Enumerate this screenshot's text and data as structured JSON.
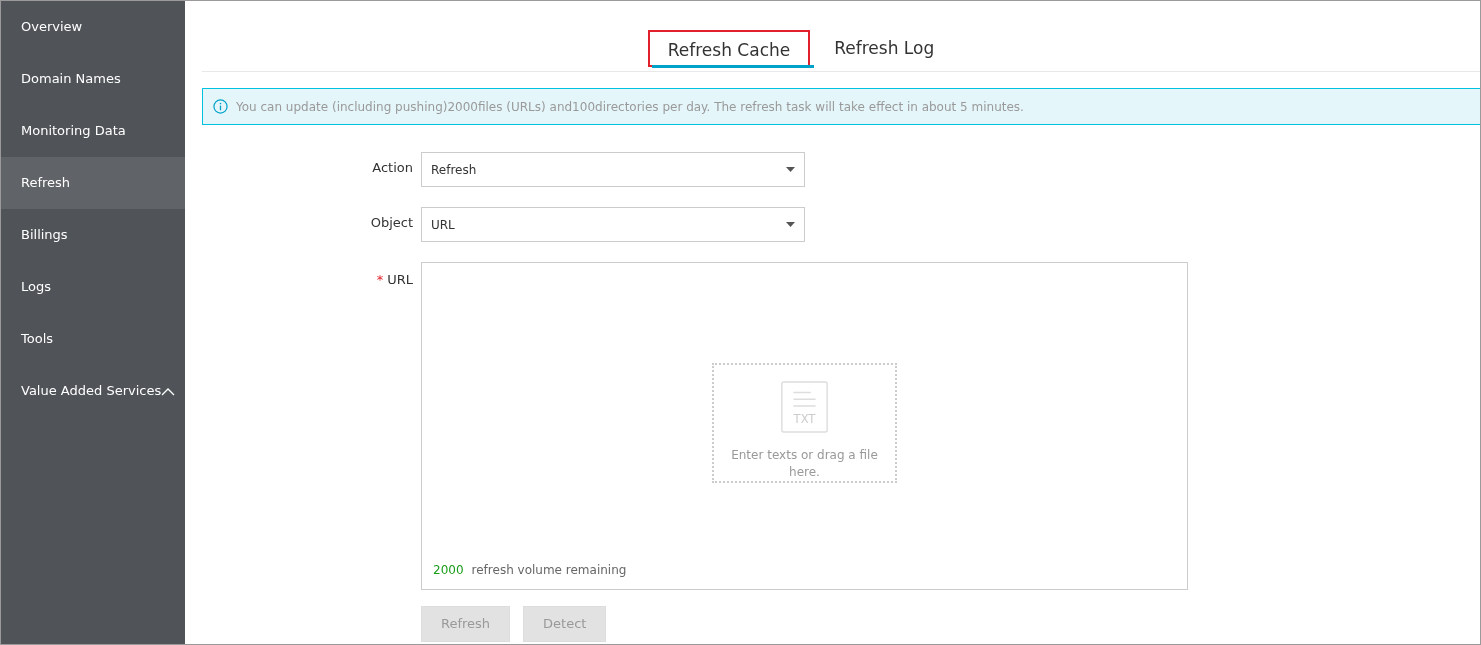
{
  "sidebar": {
    "items": [
      {
        "label": "Overview",
        "selected": false
      },
      {
        "label": "Domain Names",
        "selected": false
      },
      {
        "label": "Monitoring Data",
        "selected": false
      },
      {
        "label": "Refresh",
        "selected": true
      },
      {
        "label": "Billings",
        "selected": false
      },
      {
        "label": "Logs",
        "selected": false
      },
      {
        "label": "Tools",
        "selected": false
      },
      {
        "label": "Value Added Services",
        "selected": false,
        "expanded": true
      }
    ]
  },
  "tabs": [
    {
      "label": "Refresh Cache",
      "selected": true,
      "highlighted": true
    },
    {
      "label": "Refresh Log",
      "selected": false,
      "highlighted": false
    }
  ],
  "notice": "You can update (including pushing)2000files (URLs) and100directories per day. The refresh task will take effect in about 5 minutes.",
  "form": {
    "fields": [
      {
        "kind": "select",
        "label": "Action",
        "value": "Refresh"
      },
      {
        "kind": "select",
        "label": "Object",
        "value": "URL"
      },
      {
        "kind": "textarea",
        "label": "URL",
        "required_mark": "*",
        "drop_text": "Enter texts or drag a file here.",
        "icon_text": "TXT",
        "remaining_count": "2000",
        "remaining_label": "refresh volume remaining"
      }
    ],
    "buttons": [
      {
        "label": "Refresh",
        "disabled": true
      },
      {
        "label": "Detect",
        "disabled": true
      }
    ]
  }
}
